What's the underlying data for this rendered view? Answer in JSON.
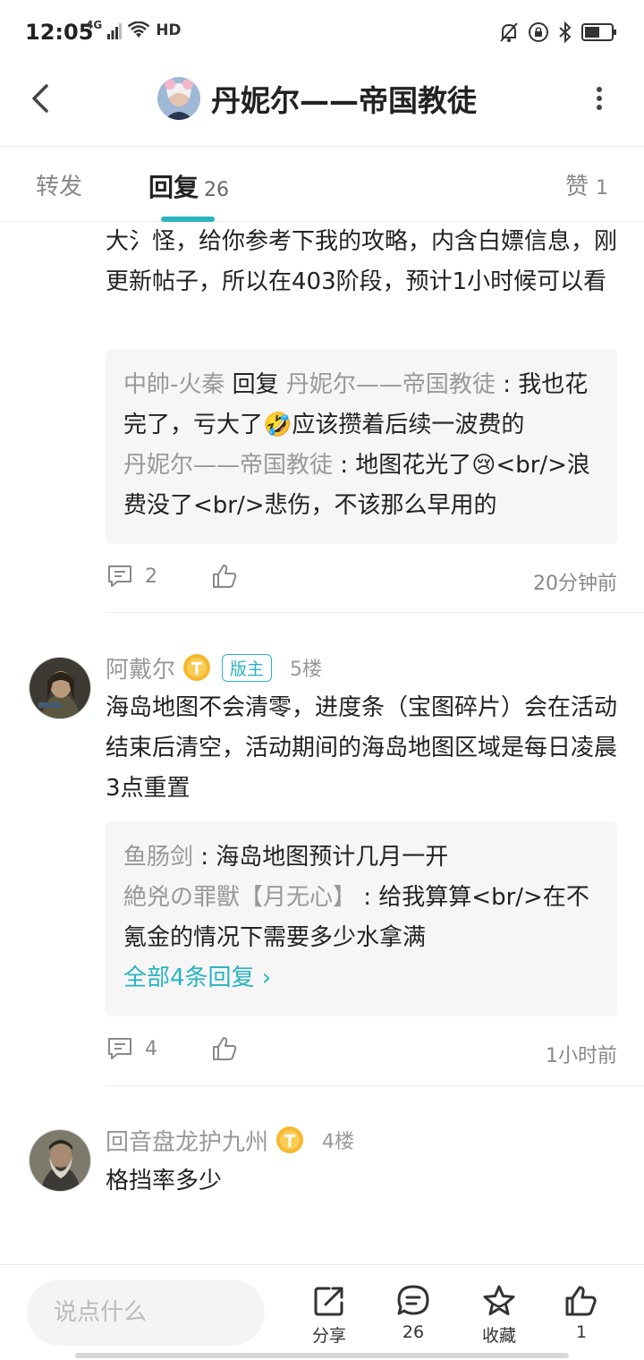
{
  "status_bar": {
    "time": "12:05",
    "network": "4G",
    "hd": "HD",
    "icons": [
      "signal-icon",
      "wifi-icon",
      "mute-icon",
      "lock-rotation-icon",
      "bluetooth-icon",
      "battery-icon"
    ]
  },
  "header": {
    "title": "丹妮尔——帝国教徒",
    "icons": [
      "back-arrow-icon",
      "more-vertical-icon"
    ]
  },
  "tabs": [
    {
      "label": "转发",
      "count": ""
    },
    {
      "label": "回复",
      "count": "26"
    },
    {
      "label": "赞",
      "count": "1"
    }
  ],
  "accent_color": "#2bb3c0",
  "comments": [
    {
      "text": "大氵怪，给你参考下我的攻略，内含白嫖信息，刚更新帖子，所以在403阶段，预计1小时候可以看",
      "replies": [
        {
          "name": "中帥-火秦",
          "mid": " 回复 ",
          "target": "丹妮尔——帝国教徒",
          "text": " : 我也花完了，亏大了🤣应该攒着后续一波费的"
        },
        {
          "name": "丹妮尔——帝国教徒",
          "text": " : 地图花光了😢<br/>浪费没了<br/>悲伤，不该那么早用的"
        }
      ],
      "comment_count": "2",
      "time": "20分钟前"
    },
    {
      "user": "阿戴尔",
      "badge": "版主",
      "floor": "5楼",
      "text": "海岛地图不会清零，进度条（宝图碎片）会在活动结束后清空，活动期间的海岛地图区域是每日凌晨3点重置",
      "replies": [
        {
          "name": "鱼肠剑",
          "text": " : 海岛地图预计几月一开"
        },
        {
          "name": "絶兇の罪獸【月无心】",
          "text": " : 给我算算<br/>在不氪金的情况下需要多少水拿满"
        }
      ],
      "all_replies": "全部4条回复 ›",
      "comment_count": "4",
      "time": "1小时前"
    },
    {
      "user": "回音盘龙护九州",
      "floor": "4楼",
      "text": "格挡率多少"
    }
  ],
  "bottom_bar": {
    "placeholder": "说点什么",
    "share_label": "分享",
    "comment_count": "26",
    "fav_label": "收藏",
    "like_count": "1"
  }
}
